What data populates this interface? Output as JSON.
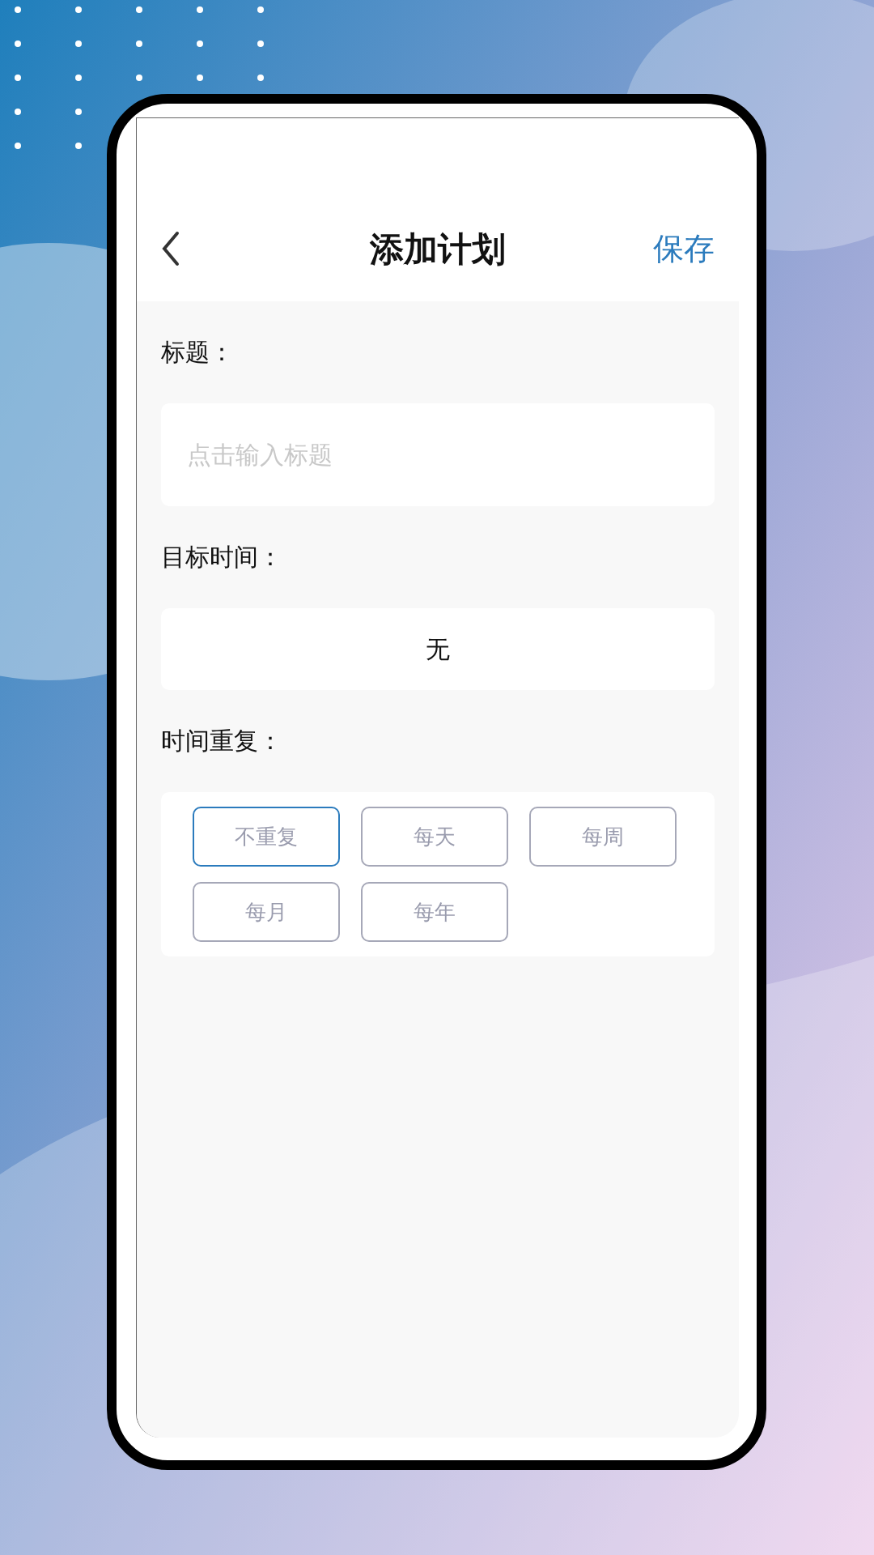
{
  "header": {
    "title": "添加计划",
    "action": "保存"
  },
  "fields": [
    {
      "kind": "input",
      "label": "标题：",
      "placeholder": "点击输入标题"
    },
    {
      "kind": "select",
      "label": "目标时间：",
      "value": "无"
    }
  ],
  "repeat": {
    "label": "时间重复：",
    "options": [
      {
        "label": "不重复",
        "selected": true
      },
      {
        "label": "每天",
        "selected": false
      },
      {
        "label": "每周",
        "selected": false
      },
      {
        "label": "每月",
        "selected": false
      },
      {
        "label": "每年",
        "selected": false
      }
    ]
  }
}
